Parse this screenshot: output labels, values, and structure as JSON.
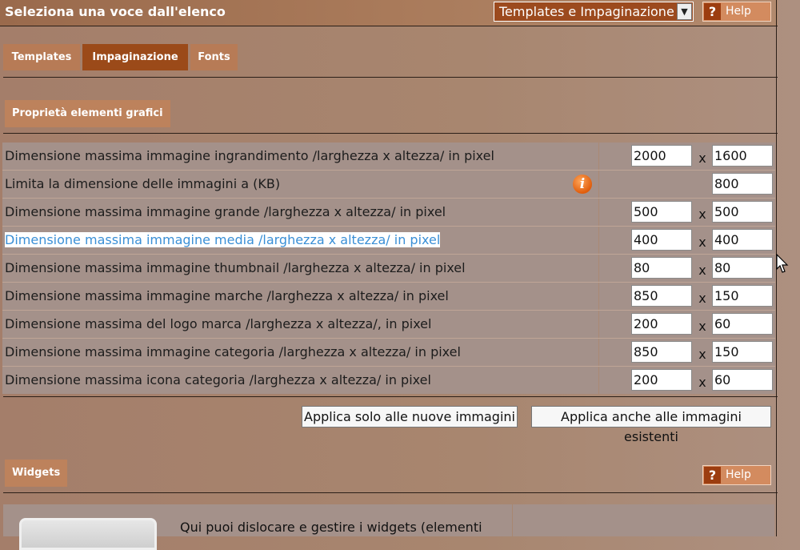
{
  "header": {
    "title": "Seleziona una voce dall'elenco",
    "section_select_value": "Templates e Impaginazione",
    "help_label": "Help"
  },
  "tabs": [
    {
      "label": "Templates",
      "active": false
    },
    {
      "label": "Impaginazione",
      "active": true
    },
    {
      "label": "Fonts",
      "active": false
    }
  ],
  "graphics": {
    "section_title": "Proprietà elementi grafici",
    "separator": "x",
    "rows": [
      {
        "label": "Dimensione massima immagine ingrandimento /larghezza x altezza/ in pixel",
        "width": "2000",
        "height": "1600"
      },
      {
        "label": "Limita la dimensione delle immagini a (KB)",
        "width": "",
        "height": "800",
        "info_icon": true
      },
      {
        "label": "Dimensione massima immagine grande /larghezza x altezza/ in pixel",
        "width": "500",
        "height": "500"
      },
      {
        "label": "Dimensione massima immagine media /larghezza x altezza/ in pixel",
        "width": "400",
        "height": "400",
        "highlighted": true
      },
      {
        "label": "Dimensione massima immagine thumbnail /larghezza x altezza/ in pixel",
        "width": "80",
        "height": "80"
      },
      {
        "label": "Dimensione massima immagine marche /larghezza x altezza/ in pixel",
        "width": "850",
        "height": "150"
      },
      {
        "label": "Dimensione massima del logo marca /larghezza x altezza/, in pixel",
        "width": "200",
        "height": "60"
      },
      {
        "label": "Dimensione massima immagine categoria /larghezza x altezza/ in pixel",
        "width": "850",
        "height": "150"
      },
      {
        "label": "Dimensione massima icona categoria /larghezza x altezza/ in pixel",
        "width": "200",
        "height": "60"
      }
    ],
    "apply_new_label": "Applica solo alle nuove immagini",
    "apply_all_label": "Applica anche alle immagini esistenti"
  },
  "widgets": {
    "section_title": "Widgets",
    "help_label": "Help",
    "description": "Qui puoi dislocare e gestire i widgets (elementi"
  },
  "colors": {
    "accent": "#9b4a19",
    "tab": "#b77b56",
    "row_bg": "#a4918a",
    "link_highlight": "#3a8fd6",
    "info_icon": "#e05d0c"
  }
}
